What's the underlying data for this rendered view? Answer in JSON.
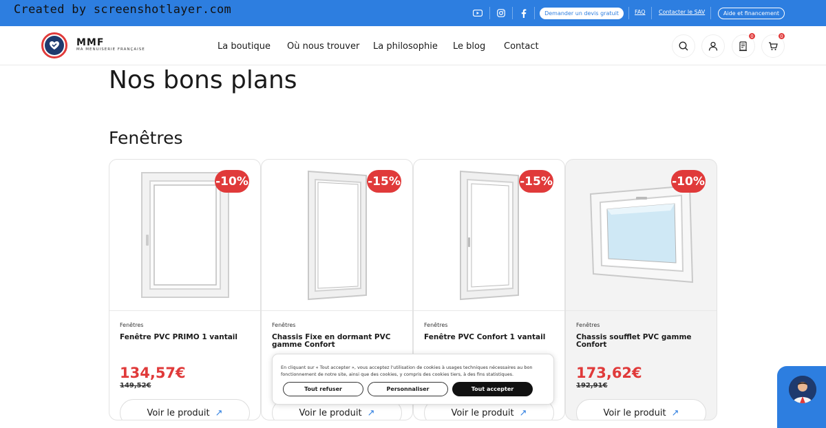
{
  "watermark": "Created by screenshotlayer.com",
  "topbar": {
    "quote_button": "Demander un devis gratuit",
    "faq": "FAQ",
    "contact_sav": "Contacter le SAV",
    "help_button": "Aide et financement"
  },
  "brand": {
    "name": "MMF",
    "tagline": "MA MENUISERIE FRANÇAISE"
  },
  "nav": [
    "La boutique",
    "Où nous trouver",
    "La philosophie",
    "Le blog",
    "Contact"
  ],
  "header_badges": {
    "quote_count": "0",
    "cart_count": "0"
  },
  "page_title": "Nos bons plans",
  "section_title": "Fenêtres",
  "products": [
    {
      "category": "Fenêtres",
      "name": "Fenêtre PVC PRIMO 1 vantail",
      "discount": "-10%",
      "price": "134,57€",
      "old_price": "149,52€",
      "cta": "Voir le produit"
    },
    {
      "category": "Fenêtres",
      "name": "Chassis Fixe en dormant PVC gamme Confort",
      "discount": "-15%",
      "price": "",
      "old_price": "",
      "cta": "Voir le produit"
    },
    {
      "category": "Fenêtres",
      "name": "Fenêtre PVC Confort 1 vantail",
      "discount": "-15%",
      "price": "",
      "old_price": "",
      "cta": "Voir le produit"
    },
    {
      "category": "Fenêtres",
      "name": "Chassis soufflet PVC gamme Confort",
      "discount": "-10%",
      "price": "173,62€",
      "old_price": "192,91€",
      "cta": "Voir le produit"
    }
  ],
  "cookie": {
    "text": "En cliquant sur « Tout accepter », vous acceptez l'utilisation de cookies à usages techniques nécessaires au bon fonctionnement de notre site, ainsi que des cookies, y compris des cookies tiers, à des fins statistiques.",
    "refuse": "Tout refuser",
    "customize": "Personnaliser",
    "accept": "Tout accepter"
  },
  "colors": {
    "primary": "#2d7ee0",
    "accent": "#e03a3a",
    "dark": "#111111"
  },
  "icons": [
    "youtube-icon",
    "instagram-icon",
    "facebook-icon",
    "search-icon",
    "user-icon",
    "quote-icon",
    "cart-icon",
    "arrow-icon"
  ]
}
